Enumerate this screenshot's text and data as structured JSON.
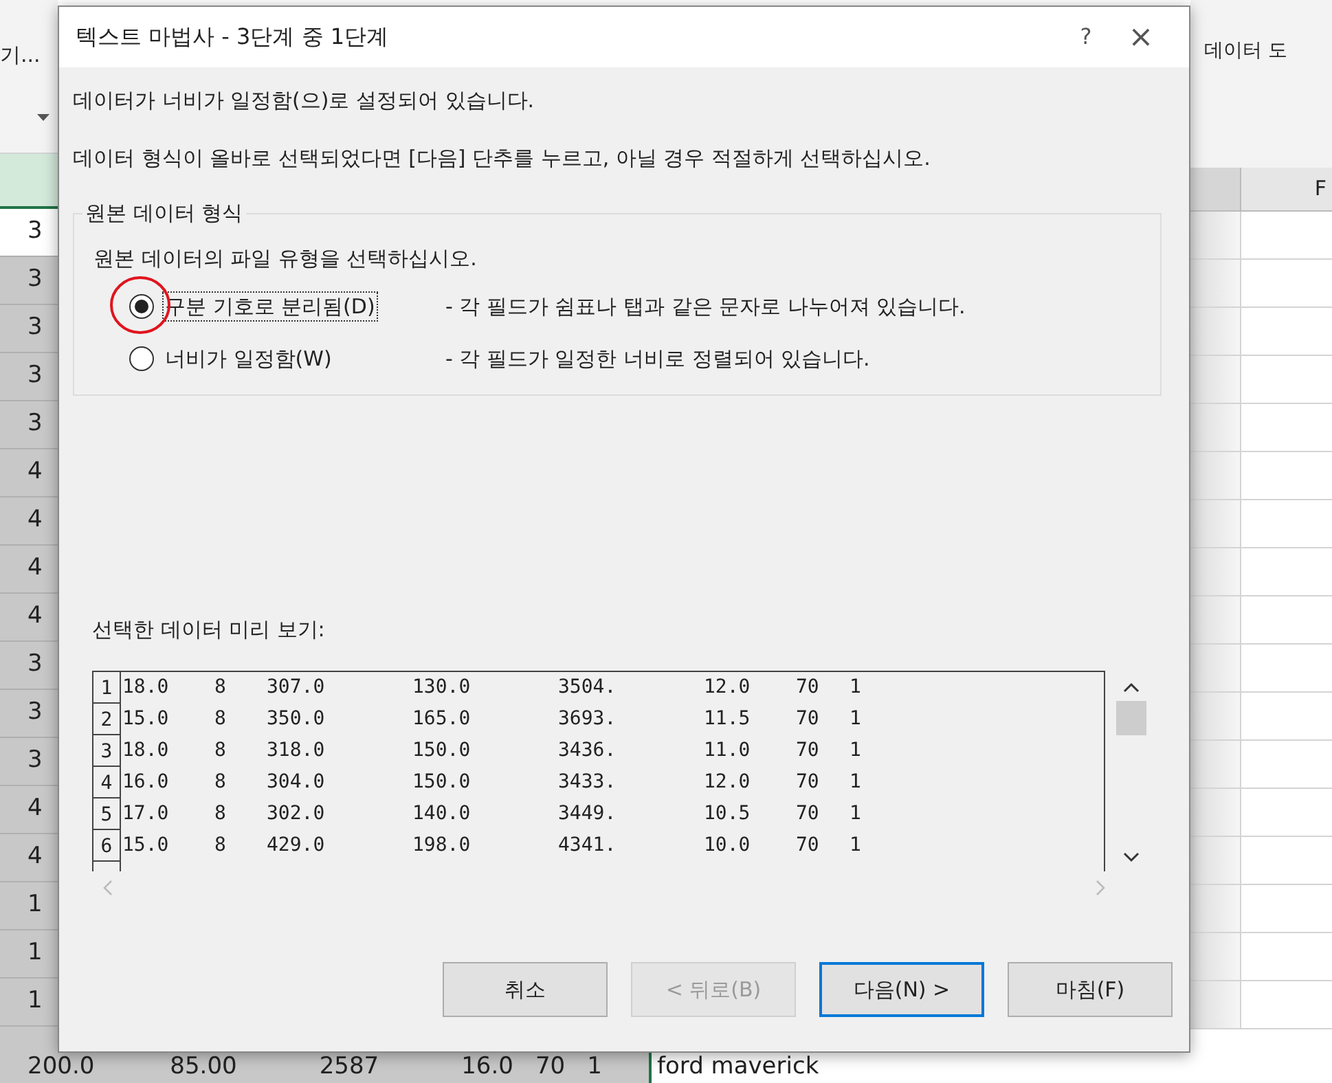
{
  "spreadsheet": {
    "ribbon_left": "기...",
    "ribbon_right": "데이터 도",
    "column_header": "F",
    "row_cells": [
      "3",
      "3",
      "3",
      "3",
      "3",
      "4",
      "4",
      "4",
      "4",
      "3",
      "3",
      "3",
      "4",
      "4",
      "1",
      "1",
      "1"
    ],
    "bottom_row": [
      "200.0",
      "85.00",
      "2587",
      "16.0",
      "70",
      "1"
    ],
    "bottom_text": "ford maverick"
  },
  "dialog": {
    "title": "텍스트 마법사 - 3단계 중 1단계",
    "help": "?",
    "close": "×",
    "messages": [
      "데이터가 너비가 일정함(으)로 설정되어 있습니다.",
      "데이터 형식이 올바로 선택되었다면 [다음] 단추를 누르고, 아닐 경우 적절하게 선택하십시오."
    ],
    "group_title": "원본 데이터 형식",
    "prompt": "원본 데이터의 파일 유형을 선택하십시오.",
    "options": [
      {
        "label": "구분 기호로 분리됨(D)",
        "description": "- 각 필드가 쉼표나 탭과 같은 문자로 나누어져 있습니다.",
        "selected": true
      },
      {
        "label": "너비가 일정함(W)",
        "description": "- 각 필드가 일정한 너비로 정렬되어 있습니다.",
        "selected": false
      }
    ],
    "preview_label": "선택한 데이터 미리 보기:",
    "preview_rows": [
      {
        "number": "1",
        "fields": [
          "18.0",
          "8",
          "307.0",
          "130.0",
          "3504.",
          "12.0",
          "70",
          "1"
        ]
      },
      {
        "number": "2",
        "fields": [
          "15.0",
          "8",
          "350.0",
          "165.0",
          "3693.",
          "11.5",
          "70",
          "1"
        ]
      },
      {
        "number": "3",
        "fields": [
          "18.0",
          "8",
          "318.0",
          "150.0",
          "3436.",
          "11.0",
          "70",
          "1"
        ]
      },
      {
        "number": "4",
        "fields": [
          "16.0",
          "8",
          "304.0",
          "150.0",
          "3433.",
          "12.0",
          "70",
          "1"
        ]
      },
      {
        "number": "5",
        "fields": [
          "17.0",
          "8",
          "302.0",
          "140.0",
          "3449.",
          "10.5",
          "70",
          "1"
        ]
      },
      {
        "number": "6",
        "fields": [
          "15.0",
          "8",
          "429.0",
          "198.0",
          "4341.",
          "10.0",
          "70",
          "1"
        ]
      }
    ],
    "buttons": [
      {
        "label": "취소",
        "disabled": false,
        "default": false
      },
      {
        "label": "< 뒤로(B)",
        "disabled": true,
        "default": false
      },
      {
        "label": "다음(N) >",
        "disabled": false,
        "default": true
      },
      {
        "label": "마침(F)",
        "disabled": false,
        "default": false
      }
    ]
  }
}
